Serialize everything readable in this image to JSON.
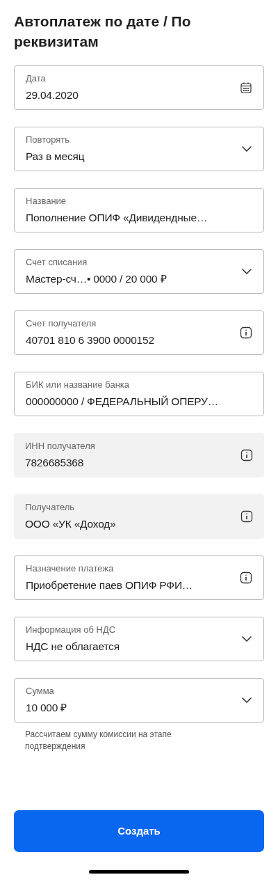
{
  "title": "Автоплатеж по дате / По реквизитам",
  "fields": [
    {
      "label": "Дата",
      "value": "29.04.2020",
      "kind": "date",
      "disabled": false
    },
    {
      "label": "Повторять",
      "value": "Раз в месяц",
      "kind": "select",
      "disabled": false
    },
    {
      "label": "Название",
      "value": "Пополнение ОПИФ «Дивидендные…",
      "kind": "text",
      "disabled": false
    },
    {
      "label": "Счет списания",
      "value": "Мастер-сч…• 0000 / 20 000 ₽",
      "kind": "select",
      "disabled": false
    },
    {
      "label": "Счет получателя",
      "value": "40701 810 6 3900 0000152",
      "kind": "info",
      "disabled": false
    },
    {
      "label": "БИК или название банка",
      "value": "000000000 / ФЕДЕРАЛЬНЫЙ ОПЕРУ…",
      "kind": "text",
      "disabled": false
    },
    {
      "label": "ИНН получателя",
      "value": "7826685368",
      "kind": "info",
      "disabled": true
    },
    {
      "label": "Получатель",
      "value": "ООО «УК «Доход»",
      "kind": "info",
      "disabled": true
    },
    {
      "label": "Назначение платежа",
      "value": "Приобретение паев ОПИФ РФИ…",
      "kind": "info",
      "disabled": false
    },
    {
      "label": "Информация об НДС",
      "value": "НДС не облагается",
      "kind": "select",
      "disabled": false
    },
    {
      "label": "Сумма",
      "value": "10 000 ₽",
      "kind": "select",
      "disabled": false,
      "hint": "Рассчитаем сумму комиссии на этапе подтверждения"
    }
  ],
  "button": "Создать"
}
